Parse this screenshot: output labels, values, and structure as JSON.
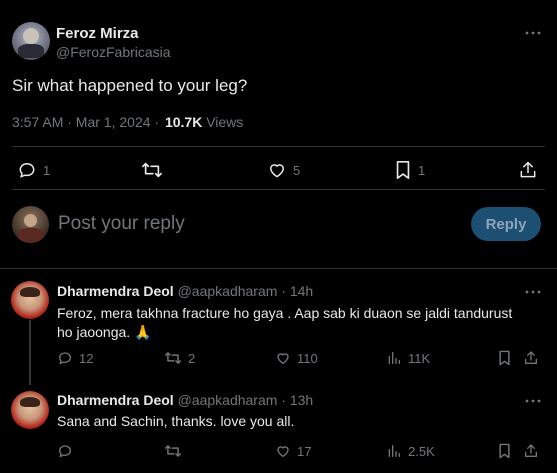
{
  "tweet": {
    "author_name": "Feroz Mirza",
    "author_handle": "@FerozFabricasia",
    "text": "Sir what happened to your leg?",
    "timestamp": "3:57 AM · Mar 1, 2024 ·",
    "views_count": "10.7K",
    "views_label": "Views",
    "more_icon": "more-horizontal-icon",
    "actions": {
      "reply_count": "1",
      "retweet_count": "",
      "like_count": "5",
      "bookmark_count": "1"
    }
  },
  "composer": {
    "placeholder": "Post your reply",
    "reply_button_label": "Reply"
  },
  "replies": [
    {
      "author_name": "Dharmendra Deol",
      "author_handle": "@aapkadharam",
      "time": "· 14h",
      "text_line1": "Feroz,  mera takhna fracture ho gaya . Aap sab ki duaon se jaldi tandurust",
      "text_line2": "ho jaoonga. 🙏",
      "reply_count": "12",
      "retweet_count": "2",
      "like_count": "110",
      "views_count": "11K"
    },
    {
      "author_name": "Dharmendra Deol",
      "author_handle": "@aapkadharam",
      "time": "· 13h",
      "text_line1": "Sana and Sachin, thanks. love you all.",
      "reply_count": "",
      "retweet_count": "",
      "like_count": "17",
      "views_count": "2.5K"
    }
  ],
  "colors": {
    "background": "#000000",
    "text": "#e7e9ea",
    "muted": "#71767b",
    "divider": "#2f3336",
    "reply_button_bg": "#1d4f73",
    "reply_button_text": "#8ba4b8"
  }
}
